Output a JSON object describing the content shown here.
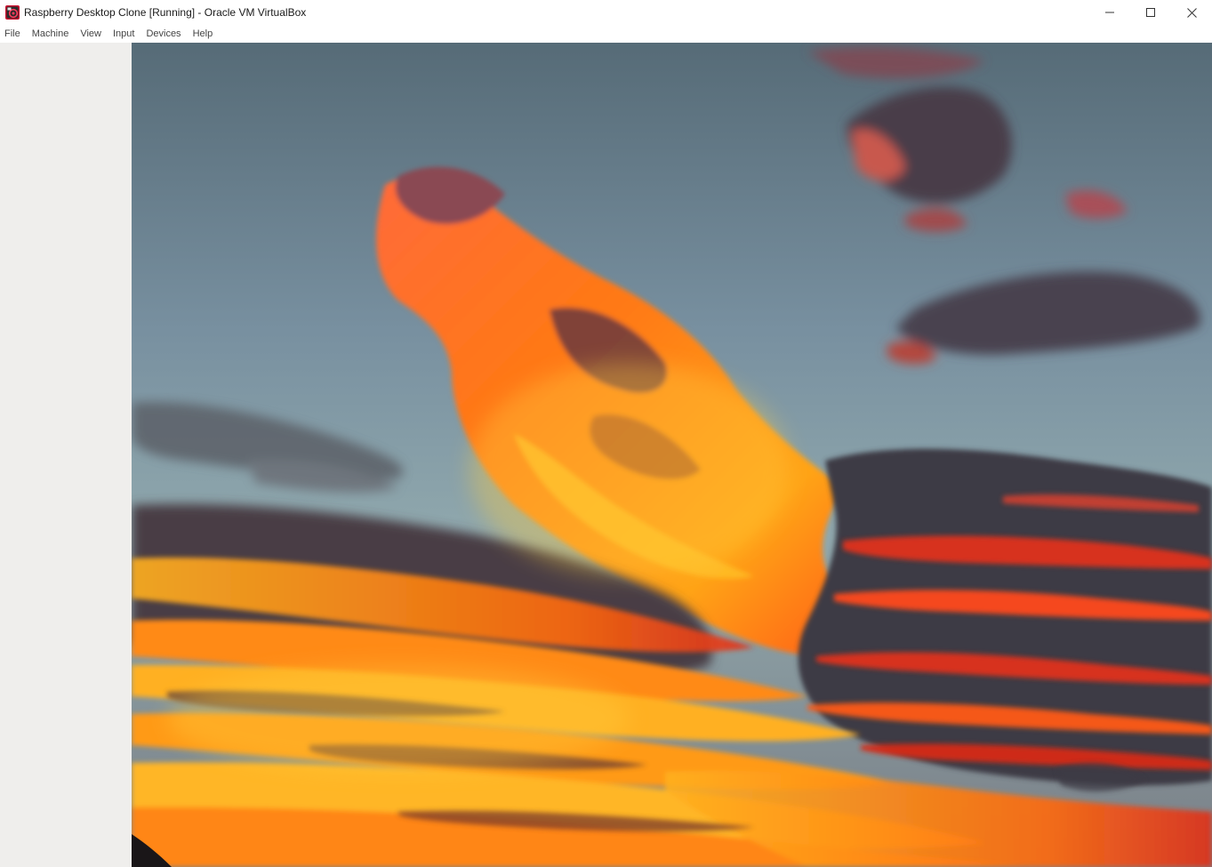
{
  "window": {
    "title": "Raspberry Desktop Clone [Running] - Oracle VM VirtualBox",
    "app_icon": "virtualbox-raspberry-icon",
    "controls": [
      "minimize-icon",
      "maximize-icon",
      "close-icon"
    ]
  },
  "menubar": {
    "items": [
      {
        "label": "File"
      },
      {
        "label": "Machine"
      },
      {
        "label": "View"
      },
      {
        "label": "Input"
      },
      {
        "label": "Devices"
      },
      {
        "label": "Help"
      }
    ]
  },
  "guest": {
    "wallpaper": "sunset-sky-wallpaper",
    "colors": {
      "sky_top": "#566b77",
      "sky_horizon": "#8fa6ab",
      "cloud_orange": "#ff7a12",
      "cloud_yellow": "#ffb020",
      "cloud_red": "#e0301a",
      "cloud_dark": "#3e3a44"
    }
  },
  "colors": {
    "gutter": "#efeeec",
    "titlebar": "#ffffff",
    "close_hover": "#e81123"
  }
}
